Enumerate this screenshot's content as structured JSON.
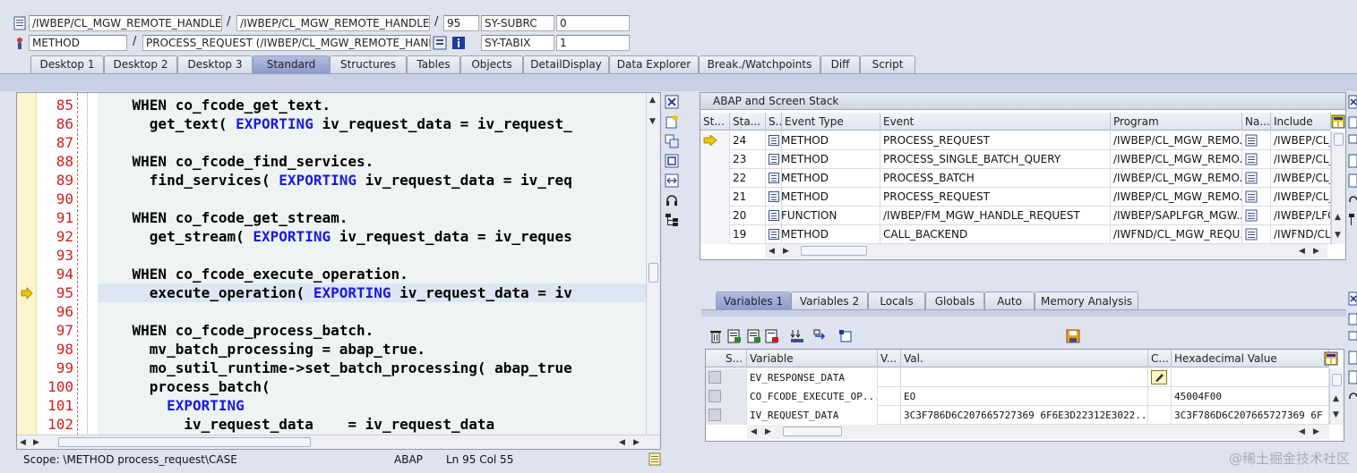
{
  "header": {
    "row1": {
      "program": "/IWBEP/CL_MGW_REMOTE_HANDLER=...",
      "include": "/IWBEP/CL_MGW_REMOTE_HANDLER=...",
      "line": "95",
      "sysvar_name": "SY-SUBRC",
      "sysvar_value": "0"
    },
    "row2": {
      "event_type": "METHOD",
      "event": "PROCESS_REQUEST (/IWBEP/CL_MGW_REMOTE_HAND...",
      "sysvar_name": "SY-TABIX",
      "sysvar_value": "1"
    },
    "separator": "/"
  },
  "tabs": [
    "Desktop 1",
    "Desktop 2",
    "Desktop 3",
    "Standard",
    "Structures",
    "Tables",
    "Objects",
    "DetailDisplay",
    "Data Explorer",
    "Break./Watchpoints",
    "Diff",
    "Script"
  ],
  "active_tab": "Standard",
  "editor": {
    "current_line": "95",
    "lines": [
      {
        "n": "85",
        "segs": [
          [
            "",
            "    WHEN co_fcode_get_text."
          ]
        ]
      },
      {
        "n": "86",
        "segs": [
          [
            "",
            "      get_text( "
          ],
          [
            "kw",
            "EXPORTING"
          ],
          [
            "",
            " iv_request_data = iv_request_"
          ]
        ]
      },
      {
        "n": "87",
        "segs": [
          [
            "",
            ""
          ]
        ]
      },
      {
        "n": "88",
        "segs": [
          [
            "",
            "    WHEN co_fcode_find_services."
          ]
        ]
      },
      {
        "n": "89",
        "segs": [
          [
            "",
            "      find_services( "
          ],
          [
            "kw",
            "EXPORTING"
          ],
          [
            "",
            " iv_request_data = iv_req"
          ]
        ]
      },
      {
        "n": "90",
        "segs": [
          [
            "",
            ""
          ]
        ]
      },
      {
        "n": "91",
        "segs": [
          [
            "",
            "    WHEN co_fcode_get_stream."
          ]
        ]
      },
      {
        "n": "92",
        "segs": [
          [
            "",
            "      get_stream( "
          ],
          [
            "kw",
            "EXPORTING"
          ],
          [
            "",
            " iv_request_data = iv_reques"
          ]
        ]
      },
      {
        "n": "93",
        "segs": [
          [
            "",
            ""
          ]
        ]
      },
      {
        "n": "94",
        "segs": [
          [
            "",
            "    WHEN co_fcode_execute_operation."
          ]
        ]
      },
      {
        "n": "95",
        "segs": [
          [
            "",
            "      execute_operation( "
          ],
          [
            "kw",
            "EXPORTING"
          ],
          [
            "",
            " iv_request_data = iv"
          ]
        ]
      },
      {
        "n": "96",
        "segs": [
          [
            "",
            ""
          ]
        ]
      },
      {
        "n": "97",
        "segs": [
          [
            "",
            "    WHEN co_fcode_process_batch."
          ]
        ]
      },
      {
        "n": "98",
        "segs": [
          [
            "",
            "      mv_batch_processing = abap_true."
          ]
        ]
      },
      {
        "n": "99",
        "segs": [
          [
            "",
            "      mo_sutil_runtime->set_batch_processing( abap_true"
          ]
        ]
      },
      {
        "n": "100",
        "segs": [
          [
            "",
            "      process_batch("
          ]
        ]
      },
      {
        "n": "101",
        "segs": [
          [
            "",
            "        "
          ],
          [
            "kw",
            "EXPORTING"
          ]
        ]
      },
      {
        "n": "102",
        "segs": [
          [
            "",
            "          iv_request_data    = iv_request_data"
          ]
        ]
      }
    ]
  },
  "status": {
    "scope": "Scope: \\METHOD process_request\\CASE",
    "language": "ABAP",
    "position": "Ln  95 Col  55"
  },
  "stack": {
    "title": "ABAP and Screen Stack",
    "columns": [
      "St...",
      "Sta...",
      "S...",
      "Event Type",
      "Event",
      "Program",
      "Na...",
      "Include"
    ],
    "rows": [
      {
        "marker": "arrow",
        "level": "24",
        "type": "METHOD",
        "event": "PROCESS_REQUEST",
        "program": "/IWBEP/CL_MGW_REMO...",
        "include": "/IWBEP/CL_"
      },
      {
        "marker": "",
        "level": "23",
        "type": "METHOD",
        "event": "PROCESS_SINGLE_BATCH_QUERY",
        "program": "/IWBEP/CL_MGW_REMO...",
        "include": "/IWBEP/CL_"
      },
      {
        "marker": "",
        "level": "22",
        "type": "METHOD",
        "event": "PROCESS_BATCH",
        "program": "/IWBEP/CL_MGW_REMO...",
        "include": "/IWBEP/CL_"
      },
      {
        "marker": "",
        "level": "21",
        "type": "METHOD",
        "event": "PROCESS_REQUEST",
        "program": "/IWBEP/CL_MGW_REMO...",
        "include": "/IWBEP/CL_"
      },
      {
        "marker": "",
        "level": "20",
        "type": "FUNCTION",
        "event": "/IWBEP/FM_MGW_HANDLE_REQUEST",
        "program": "/IWBEP/SAPLFGR_MGW...",
        "include": "/IWBEP/LFG"
      },
      {
        "marker": "",
        "level": "19",
        "type": "METHOD",
        "event": "CALL_BACKEND",
        "program": "/IWFND/CL_MGW_REQU...",
        "include": "/IWFND/CL_"
      }
    ]
  },
  "variables": {
    "tabs": [
      "Variables 1",
      "Variables 2",
      "Locals",
      "Globals",
      "Auto",
      "Memory Analysis"
    ],
    "active_tab": "Variables 1",
    "columns": [
      "S...",
      "Variable",
      "V...",
      "Val.",
      "C...",
      "Hexadecimal Value"
    ],
    "rows": [
      {
        "name": "EV_RESPONSE_DATA",
        "value": "",
        "hex": "",
        "edit": true
      },
      {
        "name": "CO_FCODE_EXECUTE_OP...",
        "value": "EO",
        "hex": "45004F00",
        "edit": false
      },
      {
        "name": "IV_REQUEST_DATA",
        "value": "3C3F786D6C207665727369 6F6E3D22312E3022...",
        "hex": "3C3F786D6C207665727369 6F",
        "edit": false
      }
    ]
  },
  "watermark": "@稀土掘金技术社区",
  "colors": {
    "keyword": "#1a1ae0",
    "line_number": "#d02020",
    "active_tab": "#9aa6d6"
  }
}
